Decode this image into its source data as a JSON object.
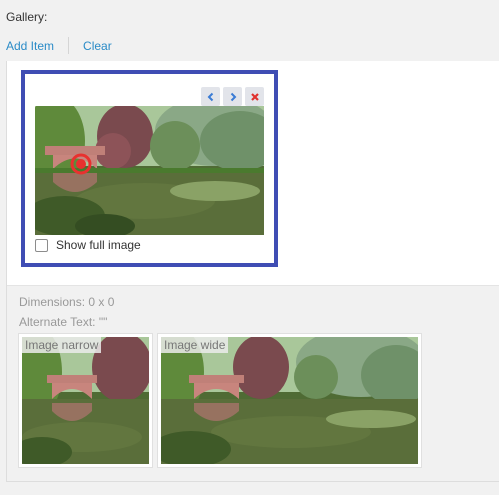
{
  "field": {
    "label": "Gallery:"
  },
  "actions": {
    "add_item": "Add Item",
    "clear": "Clear"
  },
  "item": {
    "controls": [
      {
        "icon": "chevron-left-icon",
        "color": "#3a7bd5"
      },
      {
        "icon": "chevron-right-icon",
        "color": "#3a7bd5"
      },
      {
        "icon": "close-icon",
        "color": "#e0322f"
      }
    ],
    "show_full_image_label": "Show full image",
    "show_full_image_checked": false,
    "selection_color": "#3f4db4"
  },
  "meta": {
    "dimensions": "Dimensions: 0 x 0",
    "alt_text": "Alternate Text: \"\""
  },
  "previews": [
    {
      "tag": "Image narrow"
    },
    {
      "tag": "Image wide"
    }
  ],
  "colors": {
    "link": "#2a8bc7",
    "focal_point": "#e8312f"
  }
}
